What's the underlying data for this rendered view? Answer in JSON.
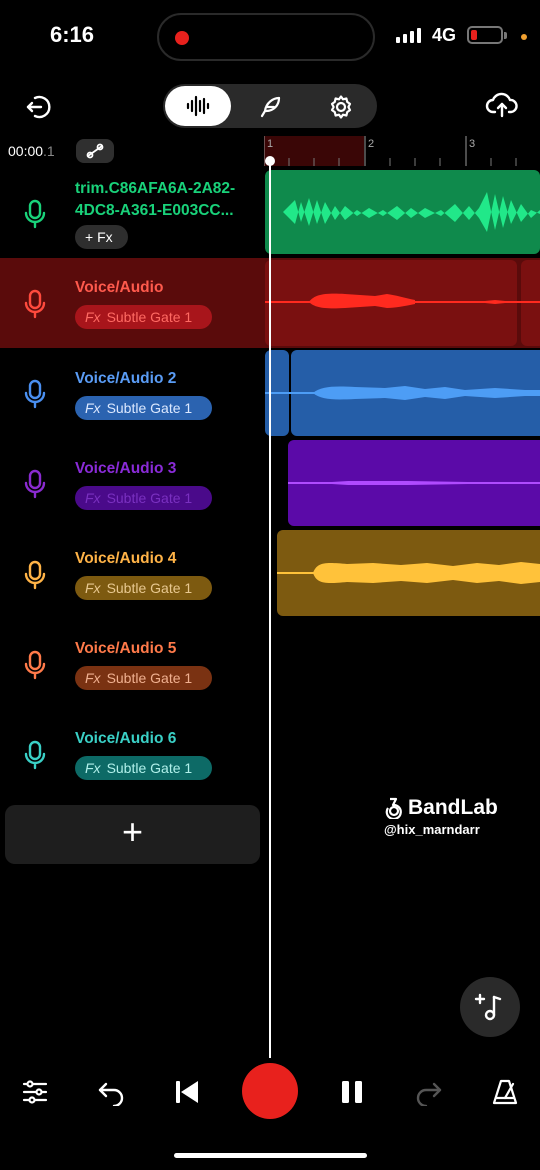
{
  "status_bar": {
    "time": "6:16",
    "network": "4G",
    "colors": {
      "battery_low": "#e8211d",
      "recording_dot": "#e8211d",
      "privacy_dot": "#f0a030"
    }
  },
  "toolbar": {
    "active_tab": "waveform",
    "tabs": [
      "waveform-icon",
      "feather-icon",
      "gear-icon"
    ],
    "left_icon": "exit-icon",
    "right_icon": "cloud-upload-icon"
  },
  "transport_info": {
    "timecode_main": "00:00",
    "timecode_fraction": ".1"
  },
  "ruler": {
    "bars": [
      "1",
      "2",
      "3"
    ]
  },
  "tracks": [
    {
      "name_line1": "trim.C86AFA6A-2A82-",
      "name_line2": "4DC8-A361-E003CC...",
      "fx_label": "+ Fx",
      "color": "#19d27a",
      "clip_color": "#0f8a4c",
      "wave_color": "#21e889"
    },
    {
      "name": "Voice/Audio",
      "fx_prefix": "Fx",
      "fx_label": "Subtle Gate 1",
      "color": "#ff4a3d",
      "clip_color": "#7a1010",
      "wave_color": "#ff2a1f",
      "chip_bg": "#a8151b",
      "chip_fg": "#ff6a63"
    },
    {
      "name": "Voice/Audio 2",
      "fx_prefix": "Fx",
      "fx_label": "Subtle Gate 1",
      "color": "#4a8ff0",
      "clip_color": "#255ea8",
      "wave_color": "#4d9df5",
      "chip_bg": "#2b63b0",
      "chip_fg": "#cfe2ff"
    },
    {
      "name": "Voice/Audio 3",
      "fx_prefix": "Fx",
      "fx_label": "Subtle Gate 1",
      "color": "#9a2be8",
      "clip_color": "#5b0aa8",
      "wave_color": "#b04bff",
      "chip_bg": "#5b0aa8",
      "chip_fg": "#8a3bd9"
    },
    {
      "name": "Voice/Audio 4",
      "fx_prefix": "Fx",
      "fx_label": "Subtle Gate 1",
      "color": "#ffb347",
      "clip_color": "#7d5a10",
      "wave_color": "#ffc23a",
      "chip_bg": "#7d5a10",
      "chip_fg": "#e0c080"
    },
    {
      "name": "Voice/Audio 5",
      "fx_prefix": "Fx",
      "fx_label": "Subtle Gate 1",
      "color": "#ff7a4a",
      "clip_color": "#7a3a12",
      "wave_color": "#ff8a50",
      "chip_bg": "#7a3212",
      "chip_fg": "#f0b090"
    },
    {
      "name": "Voice/Audio 6",
      "fx_prefix": "Fx",
      "fx_label": "Subtle Gate 1",
      "color": "#3ad0c6",
      "clip_color": "#0d6a66",
      "wave_color": "#3ad0c6",
      "chip_bg": "#0d6a66",
      "chip_fg": "#b0f0ea"
    }
  ],
  "add_track_label": "+",
  "watermark": {
    "brand": "BandLab",
    "user": "@hix_marndarr"
  },
  "bottom_bar": [
    "mixer-icon",
    "undo-icon",
    "skip-back-icon",
    "record-button",
    "pause-icon",
    "redo-icon",
    "metronome-icon"
  ],
  "fab_icon": "add-music-note-icon"
}
